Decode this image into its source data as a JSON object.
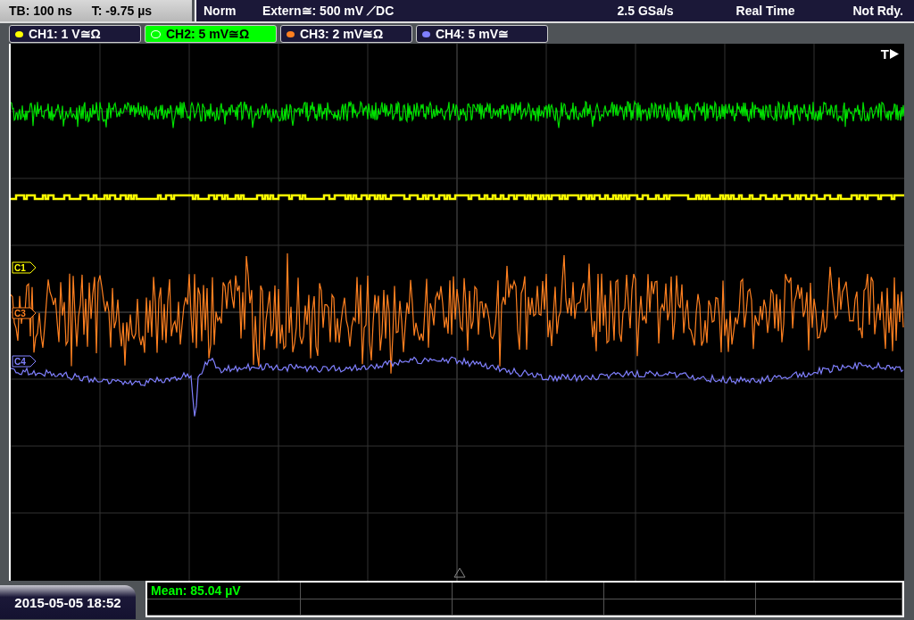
{
  "header": {
    "timebase": "TB: 100 ns",
    "trigger_time": "T: -9.75 µs",
    "mode": "Norm",
    "trigger": "Extern≅: 500 mV ⟋DC",
    "sample_rate": "2.5 GSa/s",
    "acquisition": "Real Time",
    "status": "Not Rdy."
  },
  "channels": [
    {
      "label": "CH1: 1 V≅Ω",
      "color": "#ffff00",
      "selected": false
    },
    {
      "label": "CH2: 5 mV≅Ω",
      "color": "#00ff00",
      "selected": true
    },
    {
      "label": "CH3: 2 mV≅Ω",
      "color": "#ff8020",
      "selected": false
    },
    {
      "label": "CH4: 5 mV≅",
      "color": "#8080ff",
      "selected": false
    }
  ],
  "trigger_marker": "T",
  "traces": [
    {
      "marker": "C1",
      "color": "#ffff00"
    },
    {
      "marker": "C3",
      "color": "#ff8020"
    },
    {
      "marker": "C4",
      "color": "#8080ff"
    }
  ],
  "measurement": "Mean: 85.04 µV",
  "date": "2015-05-05 18:52"
}
